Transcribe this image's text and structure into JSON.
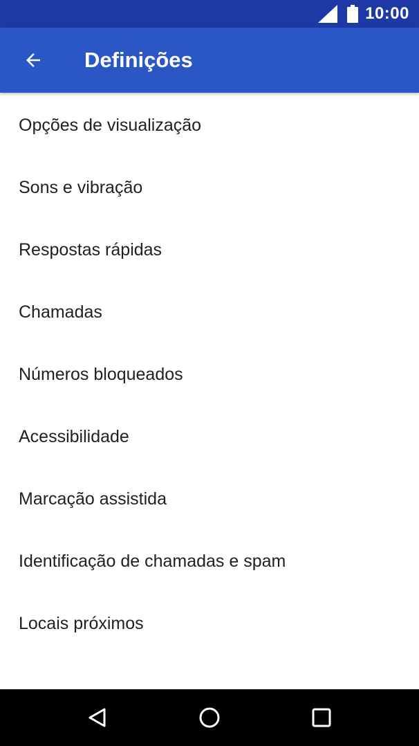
{
  "status_bar": {
    "time": "10:00",
    "icons": [
      "signal-icon",
      "battery-icon"
    ]
  },
  "app_bar": {
    "title": "Definições",
    "back_icon": "arrow-back-icon",
    "color": "#2a56c6"
  },
  "settings": {
    "items": [
      {
        "label": "Opções de visualização"
      },
      {
        "label": "Sons e vibração"
      },
      {
        "label": "Respostas rápidas"
      },
      {
        "label": "Chamadas"
      },
      {
        "label": "Números bloqueados"
      },
      {
        "label": "Acessibilidade"
      },
      {
        "label": "Marcação assistida"
      },
      {
        "label": "Identificação de chamadas e spam"
      },
      {
        "label": "Locais próximos"
      }
    ]
  },
  "nav_bar": {
    "buttons": [
      "back-triangle-icon",
      "home-circle-icon",
      "recents-square-icon"
    ]
  },
  "colors": {
    "status_bar": "#1c39a6",
    "app_bar": "#2a56c6",
    "text": "#212121",
    "nav_bar": "#000000"
  }
}
